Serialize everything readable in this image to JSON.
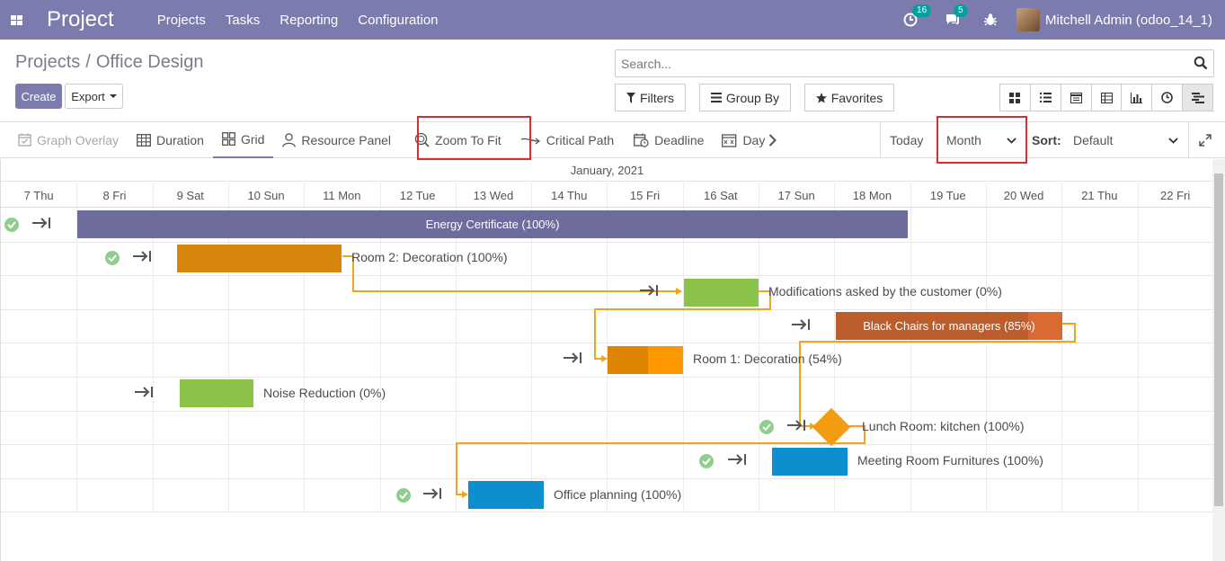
{
  "app": {
    "name": "Project"
  },
  "menu": [
    "Projects",
    "Tasks",
    "Reporting",
    "Configuration"
  ],
  "systray": {
    "activity_count": "16",
    "message_count": "5",
    "user": "Mitchell Admin (odoo_14_1)"
  },
  "breadcrumb": {
    "parent": "Projects",
    "sep": "/",
    "current": "Office Design"
  },
  "buttons": {
    "create": "Create",
    "export": "Export"
  },
  "search": {
    "placeholder": "Search..."
  },
  "filters": {
    "filters": "Filters",
    "group_by": "Group By",
    "favorites": "Favorites"
  },
  "views": [
    "kanban-icon",
    "list-icon",
    "calendar-icon",
    "pivot-icon",
    "graph-icon",
    "activity-icon",
    "gantt-icon"
  ],
  "gantt_toolbar": {
    "graph_overlay": "Graph Overlay",
    "duration": "Duration",
    "grid": "Grid",
    "resource_panel": "Resource Panel",
    "zoom_to_fit": "Zoom To Fit",
    "critical_path": "Critical Path",
    "deadline": "Deadline",
    "day": "Day",
    "today": "Today",
    "scale": "Month",
    "sort_label": "Sort:",
    "sort_value": "Default"
  },
  "gantt": {
    "month": "January, 2021",
    "days": [
      "7 Thu",
      "8 Fri",
      "9 Sat",
      "10 Sun",
      "11 Mon",
      "12 Tue",
      "13 Wed",
      "14 Thu",
      "15 Fri",
      "16 Sat",
      "17 Sun",
      "18 Mon",
      "19 Tue",
      "20 Wed",
      "21 Thu",
      "22 Fri"
    ],
    "tasks": [
      {
        "label": "Energy Certificate (100%)",
        "progress": 1.0,
        "done": true,
        "color": "#6d6c9d"
      },
      {
        "label": "Room 2: Decoration (100%)",
        "progress": 1.0,
        "done": true,
        "color": "#d6860b"
      },
      {
        "label": "Modifications asked by the customer (0%)",
        "progress": 0.0,
        "done": false,
        "color": "#8bc34a"
      },
      {
        "label": "Black Chairs for managers (85%)",
        "progress": 0.85,
        "done": false,
        "color": "#d96b32"
      },
      {
        "label": "Room 1: Decoration (54%)",
        "progress": 0.54,
        "done": false,
        "color": "#ff9800"
      },
      {
        "label": "Noise Reduction (0%)",
        "progress": 0.0,
        "done": false,
        "color": "#8bc34a"
      },
      {
        "label": "Lunch Room: kitchen (100%)",
        "progress": 1.0,
        "done": true,
        "color": "#f39c12"
      },
      {
        "label": "Meeting Room Furnitures (100%)",
        "progress": 1.0,
        "done": true,
        "color": "#0d8fcf"
      },
      {
        "label": "Office planning (100%)",
        "progress": 1.0,
        "done": true,
        "color": "#0d8fcf"
      }
    ],
    "link_color": "#f5a31a"
  }
}
